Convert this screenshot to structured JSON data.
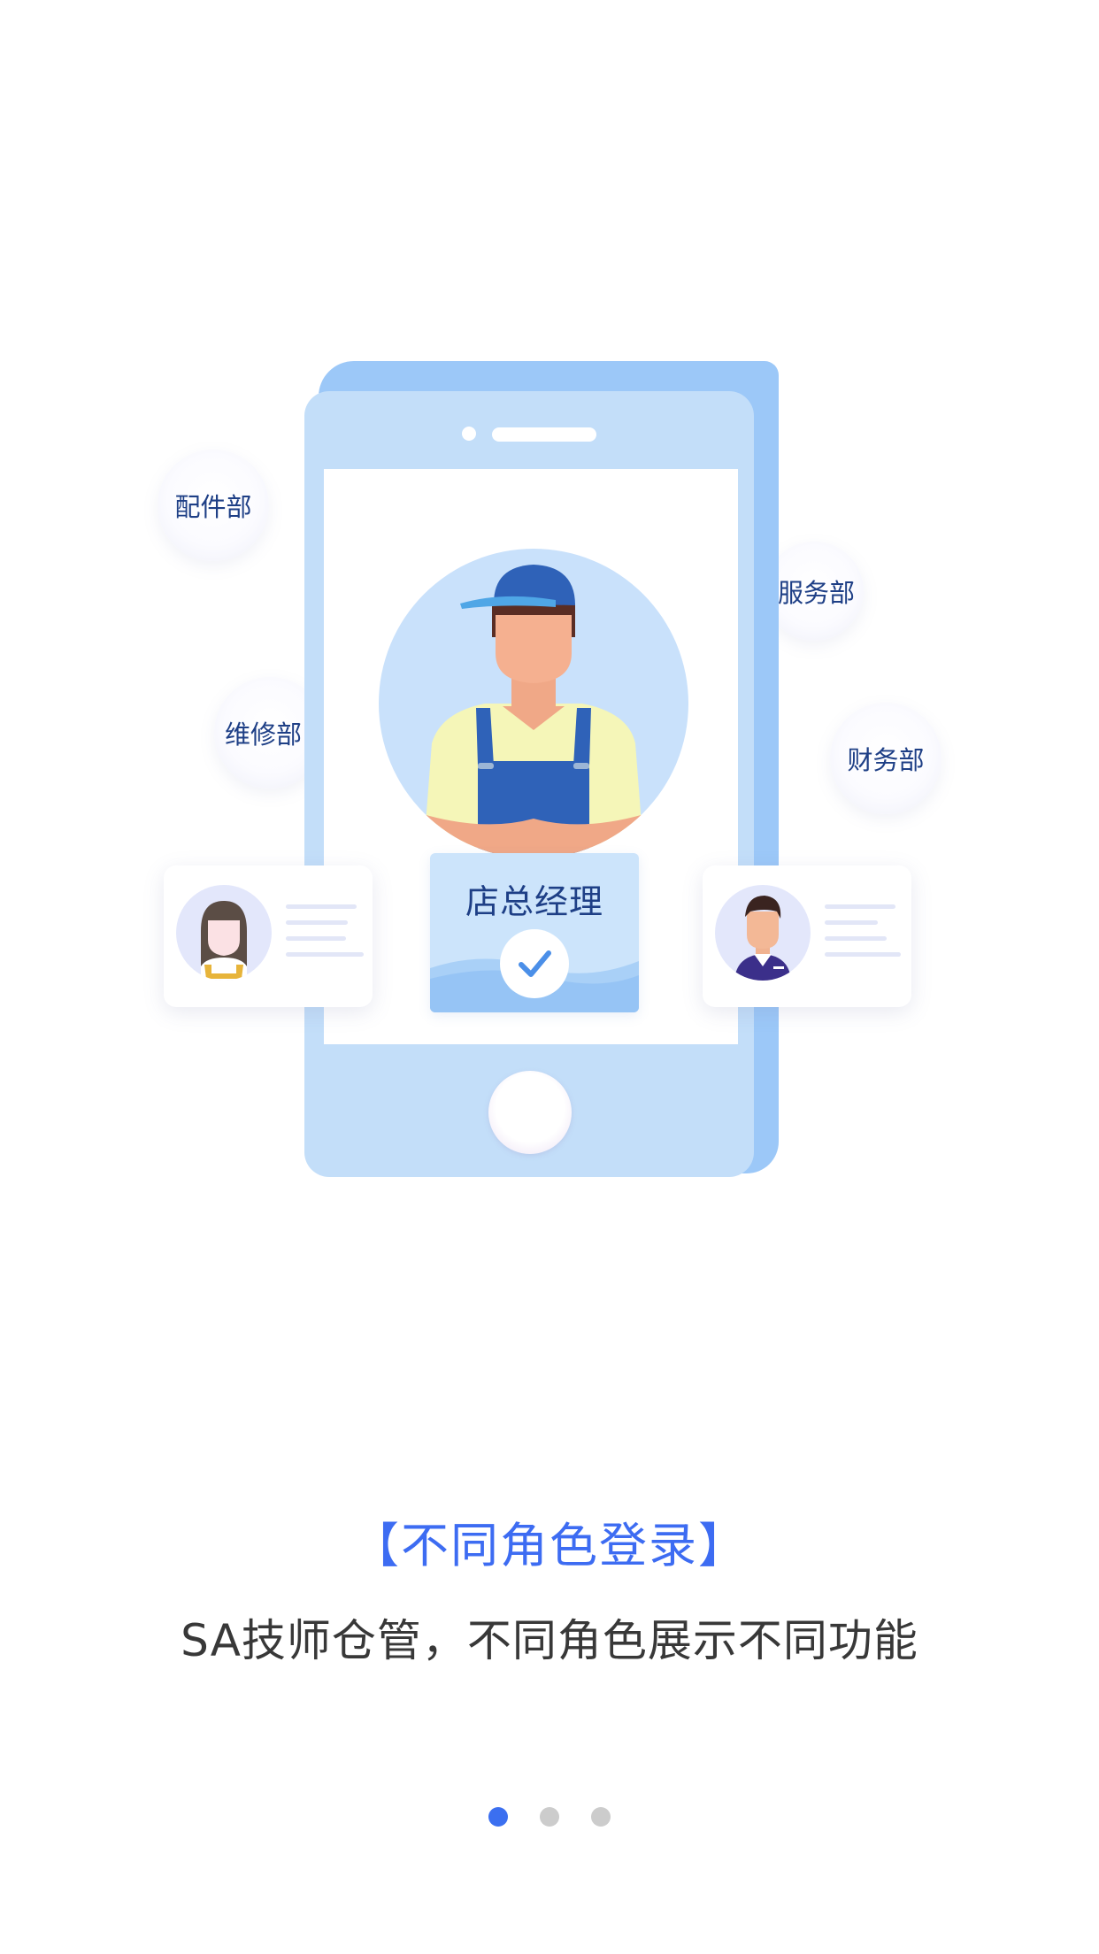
{
  "departments": {
    "parts": "配件部",
    "repair": "维修部",
    "service": "服务部",
    "finance": "财务部"
  },
  "role_card": {
    "label": "店总经理",
    "icon": "check-icon"
  },
  "onboarding": {
    "title": "【不同角色登录】",
    "subtitle": "SA技师仓管，不同角色展示不同功能"
  },
  "pager": {
    "total": 3,
    "active_index": 0
  },
  "colors": {
    "accent": "#3b6ff0",
    "phone": "#c3def9",
    "dept_text": "#1e3f86"
  }
}
